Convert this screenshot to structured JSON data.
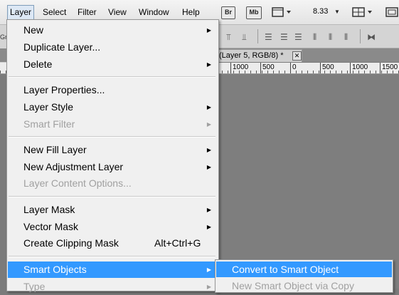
{
  "menubar": {
    "items": [
      "Layer",
      "Select",
      "Filter",
      "View",
      "Window",
      "Help"
    ],
    "active": "Layer",
    "toolbar": {
      "br_label": "Br",
      "mb_label": "Mb",
      "zoom": "8.33"
    }
  },
  "document_tab": {
    "title": "(Layer 5, RGB/8) *",
    "close": "✕"
  },
  "ruler": {
    "ticks": [
      "1000",
      "500",
      "0",
      "500",
      "1000",
      "1500"
    ]
  },
  "left_strip": {
    "label_top": "Gr",
    "label_bottom": "og"
  },
  "layer_menu": {
    "items": [
      {
        "label": "New",
        "submenu": true,
        "disabled": false
      },
      {
        "label": "Duplicate Layer...",
        "submenu": false,
        "disabled": false
      },
      {
        "label": "Delete",
        "submenu": true,
        "disabled": false
      },
      {
        "label": "Layer Properties...",
        "submenu": false,
        "disabled": false
      },
      {
        "label": "Layer Style",
        "submenu": true,
        "disabled": false
      },
      {
        "label": "Smart Filter",
        "submenu": true,
        "disabled": true
      },
      {
        "label": "New Fill Layer",
        "submenu": true,
        "disabled": false
      },
      {
        "label": "New Adjustment Layer",
        "submenu": true,
        "disabled": false
      },
      {
        "label": "Layer Content Options...",
        "submenu": false,
        "disabled": true
      },
      {
        "label": "Layer Mask",
        "submenu": true,
        "disabled": false
      },
      {
        "label": "Vector Mask",
        "submenu": true,
        "disabled": false
      },
      {
        "label": "Create Clipping Mask",
        "shortcut": "Alt+Ctrl+G",
        "submenu": false,
        "disabled": false
      },
      {
        "label": "Smart Objects",
        "submenu": true,
        "disabled": false,
        "highlighted": true
      },
      {
        "label": "Type",
        "submenu": true,
        "disabled": true
      }
    ]
  },
  "smart_objects_submenu": {
    "items": [
      {
        "label": "Convert to Smart Object",
        "highlighted": true,
        "disabled": false
      },
      {
        "label": "New Smart Object via Copy",
        "disabled": true
      }
    ]
  },
  "colors": {
    "highlight": "#3399ff",
    "menu_bg": "#f0f0f0",
    "disabled_text": "#a0a0a0"
  }
}
